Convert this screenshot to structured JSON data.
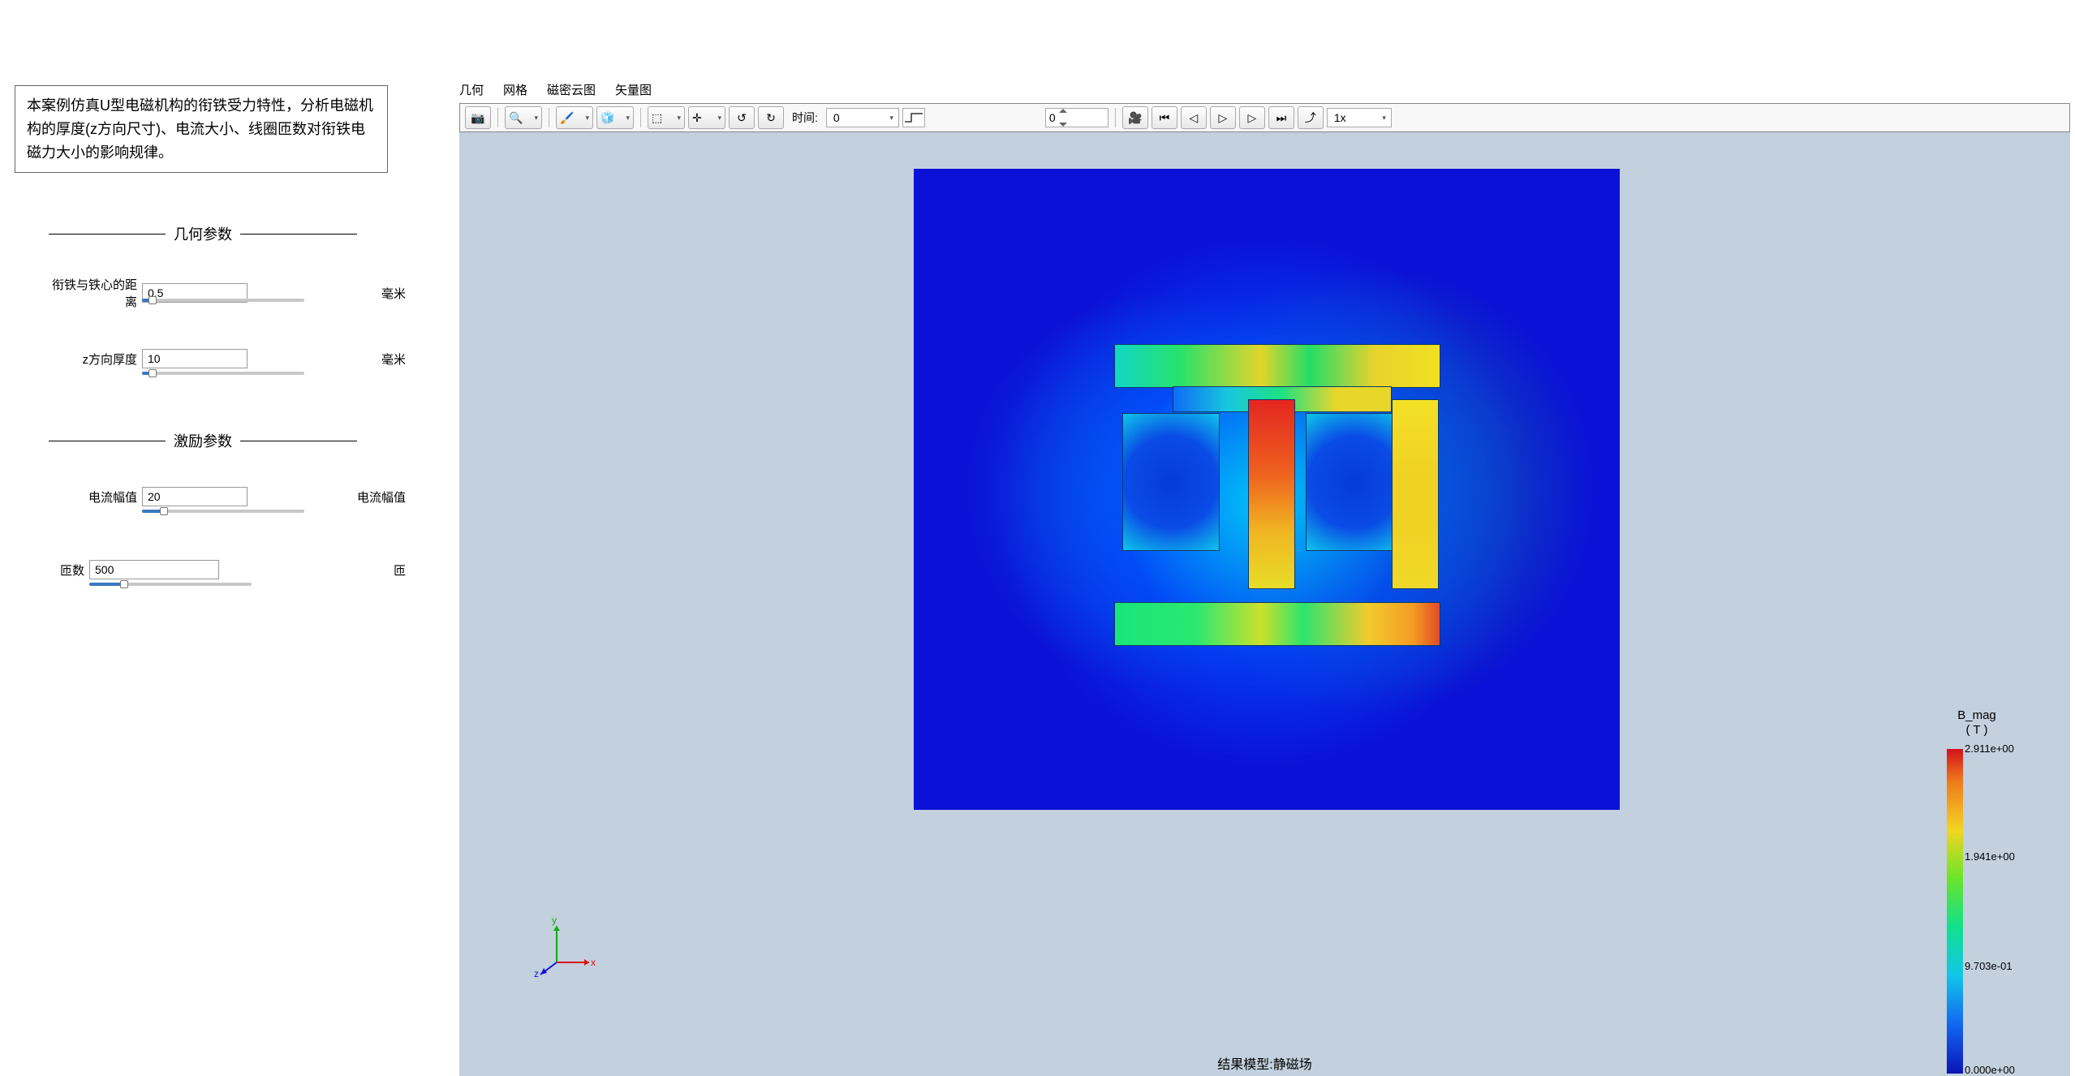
{
  "description": "本案例仿真U型电磁机构的衔铁受力特性，分析电磁机构的厚度(z方向尺寸)、电流大小、线圈匝数对衔铁电磁力大小的影响规律。",
  "sections": {
    "geometry_title": "几何参数",
    "excitation_title": "激励参数"
  },
  "params": {
    "gap": {
      "label": "衔铁与铁心的距离",
      "value": "0.5",
      "unit": "毫米",
      "slider_pct": 5
    },
    "zthick": {
      "label": "z方向厚度",
      "value": "10",
      "unit": "毫米",
      "slider_pct": 5
    },
    "current": {
      "label": "电流幅值",
      "value": "20",
      "unit": "电流幅值",
      "slider_pct": 12
    },
    "turns": {
      "label": "匝数",
      "value": "500",
      "unit": "匝",
      "slider_pct": 20
    }
  },
  "tabs": [
    "几何",
    "网格",
    "磁密云图",
    "矢量图"
  ],
  "toolbar": {
    "time_label": "时间:",
    "time_value": "0",
    "step_value": "0",
    "speed_value": "1x"
  },
  "colorbar": {
    "title1": "B_mag",
    "title2": "( T )",
    "ticks": [
      "2.911e+00",
      "1.941e+00",
      "9.703e-01",
      "0.000e+00"
    ]
  },
  "status": "结果模型:静磁场",
  "axes": {
    "x": "x",
    "y": "y",
    "z": "z"
  }
}
